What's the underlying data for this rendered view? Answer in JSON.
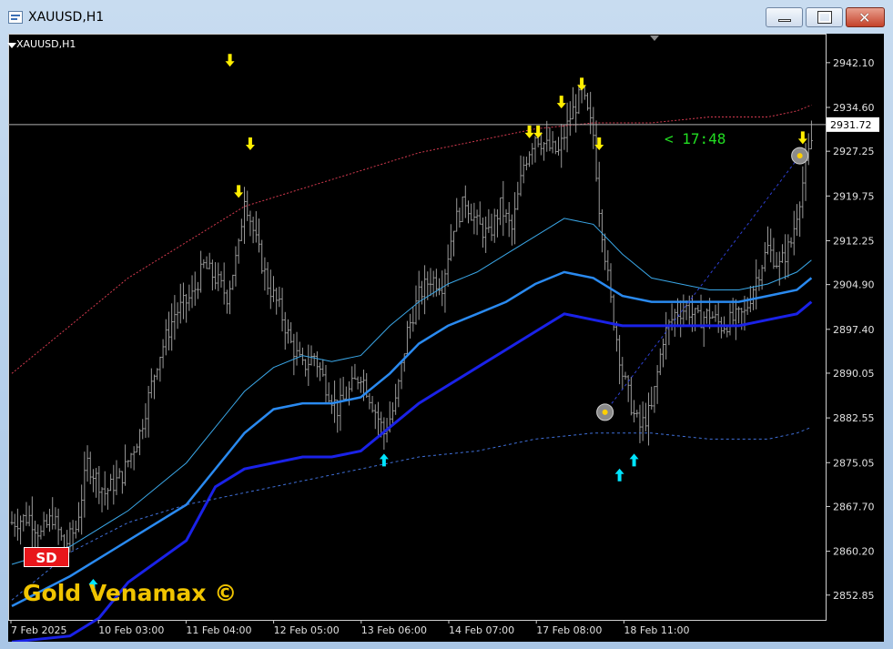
{
  "window": {
    "title": "XAUUSD,H1"
  },
  "chart_symbol_label": "XAUUSD,H1",
  "badge": "SD",
  "brand": "Gold Venamax ©",
  "timer_label": "< 17:48",
  "colors": {
    "background": "#000000",
    "candle": "#9a9a9a",
    "arrow_down": "#ffee00",
    "arrow_up": "#00e5ff",
    "band_red": "#d33a4f",
    "band_dotted_blue": "#3f6fd8",
    "line_light": "#3aa7e8",
    "line_mid": "#2a8af0",
    "line_dark": "#1a22e8",
    "timer": "#22dd22",
    "brand": "#f0c400"
  },
  "chart_data": {
    "type": "candlestick",
    "title": "",
    "x_ticks": [
      "7 Feb 2025",
      "10 Feb 03:00",
      "11 Feb 04:00",
      "12 Feb 05:00",
      "13 Feb 06:00",
      "14 Feb 07:00",
      "17 Feb 08:00",
      "18 Feb 11:00"
    ],
    "y_ticks": [
      2942.1,
      2934.6,
      2927.25,
      2919.75,
      2912.25,
      2904.9,
      2897.4,
      2890.05,
      2882.55,
      2875.05,
      2867.7,
      2860.2,
      2852.85
    ],
    "ylim": [
      2849.0,
      2946.5
    ],
    "current_price": 2931.72,
    "grid": false,
    "close_path": [
      [
        0,
        2865
      ],
      [
        6,
        2866
      ],
      [
        10,
        2863
      ],
      [
        14,
        2866
      ],
      [
        18,
        2861
      ],
      [
        22,
        2864
      ],
      [
        26,
        2875
      ],
      [
        32,
        2870
      ],
      [
        38,
        2873
      ],
      [
        44,
        2880
      ],
      [
        50,
        2892
      ],
      [
        56,
        2900
      ],
      [
        62,
        2903
      ],
      [
        66,
        2908
      ],
      [
        70,
        2906
      ],
      [
        74,
        2903
      ],
      [
        78,
        2911
      ],
      [
        80,
        2920
      ],
      [
        84,
        2912
      ],
      [
        88,
        2905
      ],
      [
        92,
        2901
      ],
      [
        96,
        2895
      ],
      [
        100,
        2891
      ],
      [
        104,
        2893
      ],
      [
        108,
        2888
      ],
      [
        112,
        2884
      ],
      [
        116,
        2887
      ],
      [
        120,
        2890
      ],
      [
        124,
        2885
      ],
      [
        128,
        2880
      ],
      [
        132,
        2885
      ],
      [
        136,
        2897
      ],
      [
        140,
        2903
      ],
      [
        144,
        2906
      ],
      [
        148,
        2905
      ],
      [
        152,
        2915
      ],
      [
        156,
        2919
      ],
      [
        160,
        2915
      ],
      [
        164,
        2913
      ],
      [
        168,
        2918
      ],
      [
        172,
        2914
      ],
      [
        176,
        2925
      ],
      [
        180,
        2930
      ],
      [
        184,
        2928
      ],
      [
        188,
        2927
      ],
      [
        192,
        2933
      ],
      [
        196,
        2937
      ],
      [
        200,
        2930
      ],
      [
        202,
        2918
      ],
      [
        206,
        2902
      ],
      [
        210,
        2890
      ],
      [
        214,
        2883
      ],
      [
        216,
        2881
      ],
      [
        220,
        2884
      ],
      [
        224,
        2896
      ],
      [
        228,
        2900
      ],
      [
        232,
        2901
      ],
      [
        236,
        2899
      ],
      [
        240,
        2900
      ],
      [
        244,
        2898
      ],
      [
        248,
        2899
      ],
      [
        252,
        2900
      ],
      [
        256,
        2906
      ],
      [
        260,
        2911
      ],
      [
        264,
        2908
      ],
      [
        268,
        2912
      ],
      [
        272,
        2922
      ],
      [
        275,
        2929
      ]
    ],
    "series": [
      {
        "values": [
          [
            0,
            2890
          ],
          [
            20,
            2898
          ],
          [
            40,
            2906
          ],
          [
            60,
            2912
          ],
          [
            80,
            2918
          ],
          [
            100,
            2921
          ],
          [
            120,
            2924
          ],
          [
            140,
            2927
          ],
          [
            160,
            2929
          ],
          [
            180,
            2931
          ],
          [
            200,
            2932
          ],
          [
            220,
            2932
          ],
          [
            240,
            2933
          ],
          [
            260,
            2933
          ],
          [
            270,
            2934
          ],
          [
            275,
            2935
          ]
        ]
      },
      {
        "values": [
          [
            0,
            2858
          ],
          [
            20,
            2861
          ],
          [
            40,
            2867
          ],
          [
            60,
            2875
          ],
          [
            80,
            2887
          ],
          [
            90,
            2891
          ],
          [
            100,
            2893
          ],
          [
            110,
            2892
          ],
          [
            120,
            2893
          ],
          [
            130,
            2898
          ],
          [
            140,
            2902
          ],
          [
            150,
            2905
          ],
          [
            160,
            2907
          ],
          [
            170,
            2910
          ],
          [
            180,
            2913
          ],
          [
            190,
            2916
          ],
          [
            200,
            2915
          ],
          [
            210,
            2910
          ],
          [
            220,
            2906
          ],
          [
            230,
            2905
          ],
          [
            240,
            2904
          ],
          [
            250,
            2904
          ],
          [
            260,
            2905
          ],
          [
            270,
            2907
          ],
          [
            275,
            2909
          ]
        ]
      },
      {
        "values": [
          [
            0,
            2851
          ],
          [
            20,
            2856
          ],
          [
            40,
            2862
          ],
          [
            60,
            2868
          ],
          [
            80,
            2880
          ],
          [
            90,
            2884
          ],
          [
            100,
            2885
          ],
          [
            110,
            2885
          ],
          [
            120,
            2886
          ],
          [
            130,
            2890
          ],
          [
            140,
            2895
          ],
          [
            150,
            2898
          ],
          [
            160,
            2900
          ],
          [
            170,
            2902
          ],
          [
            180,
            2905
          ],
          [
            190,
            2907
          ],
          [
            200,
            2906
          ],
          [
            210,
            2903
          ],
          [
            220,
            2902
          ],
          [
            230,
            2902
          ],
          [
            240,
            2902
          ],
          [
            250,
            2902
          ],
          [
            260,
            2903
          ],
          [
            270,
            2904
          ],
          [
            275,
            2906
          ]
        ]
      },
      {
        "values": [
          [
            0,
            2845
          ],
          [
            20,
            2846
          ],
          [
            30,
            2849
          ],
          [
            40,
            2855
          ],
          [
            60,
            2862
          ],
          [
            70,
            2871
          ],
          [
            80,
            2874
          ],
          [
            100,
            2876
          ],
          [
            110,
            2876
          ],
          [
            120,
            2877
          ],
          [
            130,
            2881
          ],
          [
            140,
            2885
          ],
          [
            150,
            2888
          ],
          [
            160,
            2891
          ],
          [
            170,
            2894
          ],
          [
            180,
            2897
          ],
          [
            190,
            2900
          ],
          [
            200,
            2899
          ],
          [
            210,
            2898
          ],
          [
            220,
            2898
          ],
          [
            230,
            2898
          ],
          [
            240,
            2898
          ],
          [
            250,
            2898
          ],
          [
            260,
            2899
          ],
          [
            270,
            2900
          ],
          [
            275,
            2902
          ]
        ]
      },
      {
        "values": [
          [
            0,
            2852
          ],
          [
            20,
            2860
          ],
          [
            40,
            2865
          ],
          [
            60,
            2868
          ],
          [
            80,
            2870
          ],
          [
            100,
            2872
          ],
          [
            120,
            2874
          ],
          [
            140,
            2876
          ],
          [
            160,
            2877
          ],
          [
            180,
            2879
          ],
          [
            200,
            2880
          ],
          [
            220,
            2880
          ],
          [
            240,
            2879
          ],
          [
            260,
            2879
          ],
          [
            270,
            2880
          ],
          [
            275,
            2881
          ]
        ]
      }
    ],
    "down_arrows": [
      [
        75,
        2942.5
      ],
      [
        82,
        2928.5
      ],
      [
        78,
        2920.5
      ],
      [
        178,
        2930.5
      ],
      [
        181,
        2930.5
      ],
      [
        189,
        2935.5
      ],
      [
        196,
        2938.5
      ],
      [
        202,
        2928.5
      ],
      [
        272,
        2929.5
      ]
    ],
    "up_arrows": [
      [
        28,
        2854.5
      ],
      [
        128,
        2875.5
      ],
      [
        209,
        2873
      ],
      [
        214,
        2875.5
      ]
    ],
    "markers": [
      [
        204,
        2883.5
      ],
      [
        271,
        2926.5
      ]
    ],
    "trendline": [
      [
        204,
        2883.5
      ],
      [
        271,
        2926.5
      ]
    ]
  }
}
